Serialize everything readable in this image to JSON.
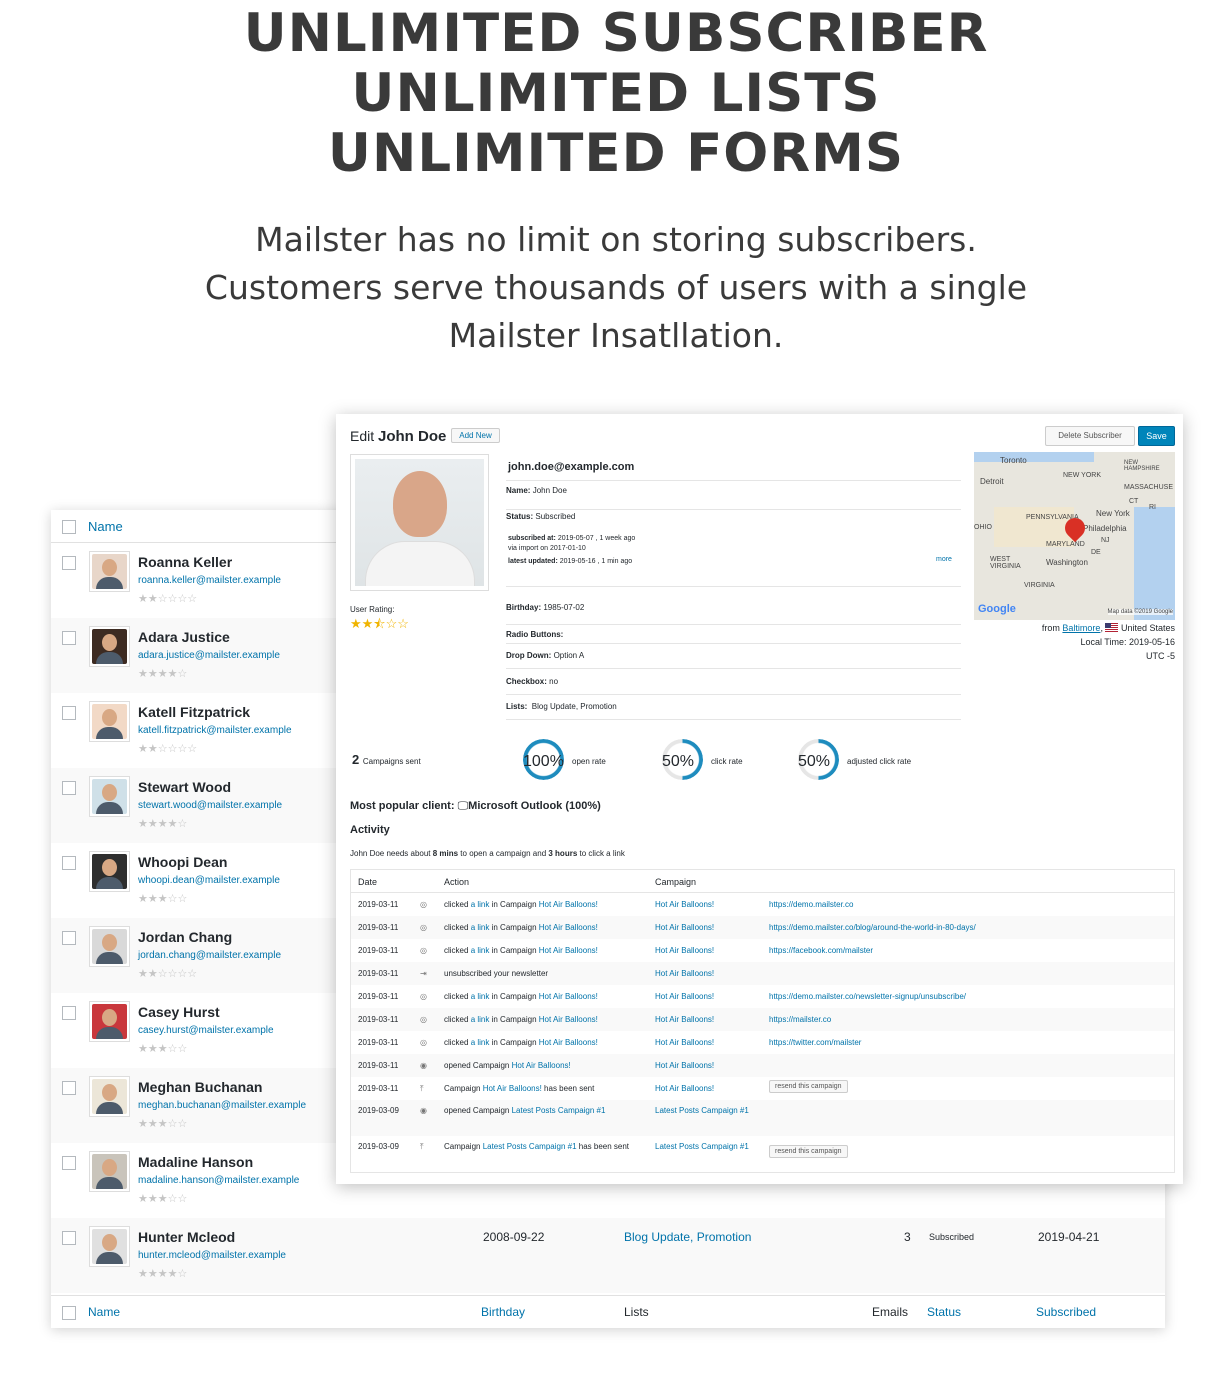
{
  "hero": {
    "title_lines": [
      "UNLIMITED SUBSCRIBER",
      "UNLIMITED LISTS",
      "UNLIMITED FORMS"
    ],
    "subtitle_lines": [
      "Mailster has no limit on storing subscribers.",
      "Customers serve thousands of users with a single",
      "Mailster Insatllation."
    ]
  },
  "list": {
    "header": {
      "name": "Name"
    },
    "rows": [
      {
        "name": "Roanna Keller",
        "email": "roanna.keller@mailster.example",
        "stars": "★★☆☆☆☆",
        "rating": 1.5
      },
      {
        "name": "Adara Justice",
        "email": "adara.justice@mailster.example",
        "stars": "★★★★☆",
        "rating": 4
      },
      {
        "name": "Katell Fitzpatrick",
        "email": "katell.fitzpatrick@mailster.example",
        "stars": "★★☆☆☆☆",
        "rating": 1.5
      },
      {
        "name": "Stewart Wood",
        "email": "stewart.wood@mailster.example",
        "stars": "★★★★☆",
        "rating": 3.5
      },
      {
        "name": "Whoopi Dean",
        "email": "whoopi.dean@mailster.example",
        "stars": "★★★☆☆",
        "rating": 3
      },
      {
        "name": "Jordan Chang",
        "email": "jordan.chang@mailster.example",
        "stars": "★★☆☆☆☆",
        "rating": 1.5
      },
      {
        "name": "Casey Hurst",
        "email": "casey.hurst@mailster.example",
        "stars": "★★★☆☆",
        "rating": 2.5
      },
      {
        "name": "Meghan Buchanan",
        "email": "meghan.buchanan@mailster.example",
        "stars": "★★★☆☆",
        "rating": 2.5
      },
      {
        "name": "Madaline Hanson",
        "email": "madaline.hanson@mailster.example",
        "stars": "★★★☆☆",
        "rating": 3
      },
      {
        "name": "Hunter Mcleod",
        "email": "hunter.mcleod@mailster.example",
        "stars": "★★★★☆",
        "rating": 3.5
      }
    ],
    "last_row": {
      "birthday": "2008-09-22",
      "list_1": "Blog Update",
      "sep": ", ",
      "list_2": "Promotion",
      "emails": "3",
      "status": "Subscribed",
      "subscribed": "2019-04-21"
    },
    "footer": {
      "name": "Name",
      "birthday": "Birthday",
      "lists": "Lists",
      "emails": "Emails",
      "status": "Status",
      "subscribed": "Subscribed"
    }
  },
  "edit": {
    "title_prefix": "Edit",
    "title_name": "John Doe",
    "add_new": "Add New",
    "delete_button": "Delete Subscriber",
    "save_button": "Save",
    "email": "john.doe@example.com",
    "name_label": "Name:",
    "name_value": "John Doe",
    "status_label": "Status:",
    "status_value": "Subscribed",
    "subscribed_at_label": "subscribed at:",
    "subscribed_at_value": "2019-05-07 , 1 week ago",
    "via": "via import on 2017-01-10",
    "latest_updated_label": "latest updated:",
    "latest_updated_value": "2019-05-16 , 1 min ago",
    "more": "more",
    "user_rating_label": "User Rating:",
    "user_rating_stars": "★★⯪☆☆",
    "user_rating": 2.5,
    "birthday_label": "Birthday:",
    "birthday_value": "1985-07-02",
    "radio_label": "Radio Buttons:",
    "dropdown_label": "Drop Down:",
    "dropdown_value": "Option A",
    "checkbox_label": "Checkbox:",
    "checkbox_value": "no",
    "lists_label": "Lists:",
    "lists_value": "Blog Update, Promotion",
    "map": {
      "labels": [
        "Toronto",
        "Detroit",
        "NEW YORK",
        "NEW HAMPSHIRE",
        "MASSACHUSE",
        "New York",
        "PENNSYLVANIA",
        "Philadelphia",
        "OHIO",
        "MARYLAND",
        "Washington",
        "WEST VIRGINIA",
        "VIRGINIA",
        "NJ",
        "DE",
        "CT",
        "RI"
      ],
      "google": "Google",
      "credit": "Map data ©2019 Google"
    },
    "from_label": "from",
    "from_city": "Baltimore",
    "from_country": "United States",
    "local_time": "Local Time: 2019-05-16",
    "utc": "UTC -5",
    "campaigns_sent_num": "2",
    "campaigns_sent_label": "Campaigns sent",
    "open_rate_value": "100%",
    "open_rate_label": "open rate",
    "open_rate": 100,
    "click_rate_value": "50%",
    "click_rate_label": "click rate",
    "click_rate": 50,
    "adj_click_value": "50%",
    "adj_click_label": "adjusted click rate",
    "adj_click_rate": 50,
    "popular_prefix": "Most popular client:",
    "popular_value": "Microsoft Outlook (100%)",
    "activity_heading": "Activity",
    "activity_note_1": "John Doe needs about ",
    "activity_note_2": "8 mins",
    "activity_note_3": " to open a campaign and ",
    "activity_note_4": "3 hours",
    "activity_note_5": " to click a link",
    "activity_headers": {
      "date": "Date",
      "action": "Action",
      "campaign": "Campaign"
    },
    "activity_rows": [
      {
        "date": "2019-03-11",
        "icon": "click-icon",
        "pre": "clicked ",
        "link": "a link",
        "mid": " in Campaign ",
        "camp_in": "Hot Air Balloons!",
        "post": "",
        "campaign": "Hot Air Balloons!",
        "url": "https://demo.mailster.co",
        "resend": ""
      },
      {
        "date": "2019-03-11",
        "icon": "click-icon",
        "pre": "clicked ",
        "link": "a link",
        "mid": " in Campaign ",
        "camp_in": "Hot Air Balloons!",
        "post": "",
        "campaign": "Hot Air Balloons!",
        "url": "https://demo.mailster.co/blog/around-the-world-in-80-days/",
        "resend": ""
      },
      {
        "date": "2019-03-11",
        "icon": "click-icon",
        "pre": "clicked ",
        "link": "a link",
        "mid": " in Campaign ",
        "camp_in": "Hot Air Balloons!",
        "post": "",
        "campaign": "Hot Air Balloons!",
        "url": "https://facebook.com/mailster",
        "resend": ""
      },
      {
        "date": "2019-03-11",
        "icon": "unsubscribe-icon",
        "pre": "unsubscribed your newsletter",
        "link": "",
        "mid": "",
        "camp_in": "",
        "post": "",
        "campaign": "Hot Air Balloons!",
        "url": "",
        "resend": ""
      },
      {
        "date": "2019-03-11",
        "icon": "click-icon",
        "pre": "clicked ",
        "link": "a link",
        "mid": " in Campaign ",
        "camp_in": "Hot Air Balloons!",
        "post": "",
        "campaign": "Hot Air Balloons!",
        "url": "https://demo.mailster.co/newsletter-signup/unsubscribe/",
        "resend": ""
      },
      {
        "date": "2019-03-11",
        "icon": "click-icon",
        "pre": "clicked ",
        "link": "a link",
        "mid": " in Campaign ",
        "camp_in": "Hot Air Balloons!",
        "post": "",
        "campaign": "Hot Air Balloons!",
        "url": "https://mailster.co",
        "resend": ""
      },
      {
        "date": "2019-03-11",
        "icon": "click-icon",
        "pre": "clicked ",
        "link": "a link",
        "mid": " in Campaign ",
        "camp_in": "Hot Air Balloons!",
        "post": "",
        "campaign": "Hot Air Balloons!",
        "url": "https://twitter.com/mailster",
        "resend": ""
      },
      {
        "date": "2019-03-11",
        "icon": "eye-icon",
        "pre": "opened Campaign ",
        "link": "",
        "mid": "",
        "camp_in": "Hot Air Balloons!",
        "post": "",
        "campaign": "Hot Air Balloons!",
        "url": "",
        "resend": ""
      },
      {
        "date": "2019-03-11",
        "icon": "send-icon",
        "pre": "Campaign ",
        "link": "",
        "mid": "",
        "camp_in": "Hot Air Balloons!",
        "post": " has been sent",
        "campaign": "Hot Air Balloons!",
        "url": "",
        "resend": "resend this campaign"
      }
    ],
    "activity_rows_tall": [
      {
        "date": "2019-03-09",
        "icon": "eye-icon",
        "pre": "opened Campaign ",
        "camp_in": "Latest Posts Campaign #1",
        "post": "",
        "campaign": "Latest Posts Campaign #1",
        "resend": ""
      },
      {
        "date": "2019-03-09",
        "icon": "send-icon",
        "pre": "Campaign ",
        "camp_in": "Latest Posts Campaign #1",
        "post": " has been sent",
        "campaign": "Latest Posts Campaign #1",
        "resend": "resend this campaign"
      }
    ]
  },
  "colors": {
    "link": "#0073aa",
    "primary": "#0085ba",
    "star": "#f0b400",
    "ring": "#1e8cbe",
    "pin": "#d93025"
  }
}
